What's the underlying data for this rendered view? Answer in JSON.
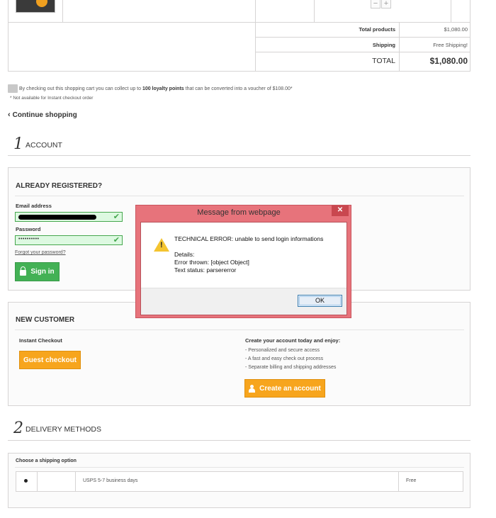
{
  "cart": {
    "qty_minus": "−",
    "qty_plus": "+",
    "total_products_label": "Total products",
    "total_products_value": "$1,080.00",
    "shipping_label": "Shipping",
    "shipping_value": "Free Shipping!",
    "total_label": "TOTAL",
    "total_value": "$1,080.00"
  },
  "loyalty": {
    "prefix": "By checking out this shopping cart you can collect up to ",
    "points": "100 loyalty points",
    "suffix": " that can be converted into a voucher of $108.00*",
    "note": "* Not available for Instant checkout order"
  },
  "continue_shopping": "Continue shopping",
  "step1": {
    "number": "1",
    "title": "ACCOUNT"
  },
  "login": {
    "title": "ALREADY REGISTERED?",
    "email_label": "Email address",
    "password_label": "Password",
    "password_value": "••••••••••",
    "forgot": "Forgot your password?",
    "sign_in": "Sign in"
  },
  "new_customer": {
    "title": "NEW CUSTOMER",
    "instant_label": "Instant Checkout",
    "guest_button": "Guest checkout",
    "create_heading": "Create your account today and enjoy:",
    "benefits": [
      "- Personalized and secure access",
      "- A fast and easy check out process",
      "- Separate billing and shipping addresses"
    ],
    "create_button": "Create an account"
  },
  "step2": {
    "number": "2",
    "title": "DELIVERY METHODS"
  },
  "delivery": {
    "choose_label": "Choose a shipping option",
    "option_name": "USPS 5-7 business days",
    "option_price": "Free"
  },
  "dialog": {
    "title": "Message from webpage",
    "close": "✕",
    "line1": "TECHNICAL ERROR: unable to send login informations",
    "details": "Details:",
    "error_thrown": "Error thrown: [object Object]",
    "text_status": "Text status: parsererror",
    "ok": "OK"
  },
  "colors": {
    "green": "#43b155",
    "orange": "#f7a51d",
    "dialog_frame": "#e7737b"
  },
  "icons": [
    "flag-icon",
    "chevron-left-icon",
    "check-icon",
    "lock-icon",
    "user-icon",
    "warning-icon",
    "close-icon"
  ]
}
